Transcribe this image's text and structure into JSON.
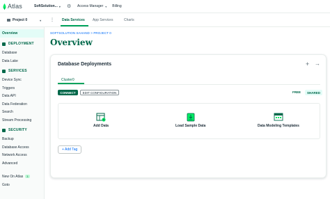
{
  "topbar": {
    "logo_text": "Atlas",
    "org_name": "SoftSolution...",
    "nav": [
      "Access Manager",
      "Billing"
    ]
  },
  "projectbar": {
    "project_name": "Project 0",
    "tabs": [
      "Data Services",
      "App Services",
      "Charts"
    ],
    "active_tab": "Data Services"
  },
  "sidebar": {
    "overview": "Overview",
    "sections": [
      {
        "title": "DEPLOYMENT",
        "items": [
          "Database",
          "Data Lake"
        ]
      },
      {
        "title": "SERVICES",
        "items": [
          "Device Sync",
          "Triggers",
          "Data API",
          "Data Federation",
          "Search",
          "Stream Processing"
        ]
      },
      {
        "title": "SECURITY",
        "items": [
          "Backup",
          "Database Access",
          "Network Access",
          "Advanced"
        ]
      }
    ],
    "footer": {
      "new_on_atlas": "New On Atlas",
      "badge": "3",
      "goto": "Goto"
    }
  },
  "main": {
    "breadcrumb": "SOFTSOLUTION SAHAND > PROJECT 0",
    "title": "Overview",
    "card": {
      "title": "Database Deployments",
      "cluster_tab": "Cluster0",
      "connect_label": "CONNECT",
      "edit_label": "EDIT CONFIGURATION",
      "tier": "FREE",
      "type": "SHARED",
      "actions": [
        {
          "label": "Add Data",
          "icon": "table-add-icon"
        },
        {
          "label": "Load Sample Data",
          "icon": "download-icon"
        },
        {
          "label": "Data Modeling Templates",
          "icon": "template-grid-icon"
        }
      ],
      "add_tag": "+ Add Tag"
    }
  },
  "colors": {
    "brand_green": "#00684a",
    "accent_green": "#00a35c",
    "link_blue": "#016bf8"
  }
}
